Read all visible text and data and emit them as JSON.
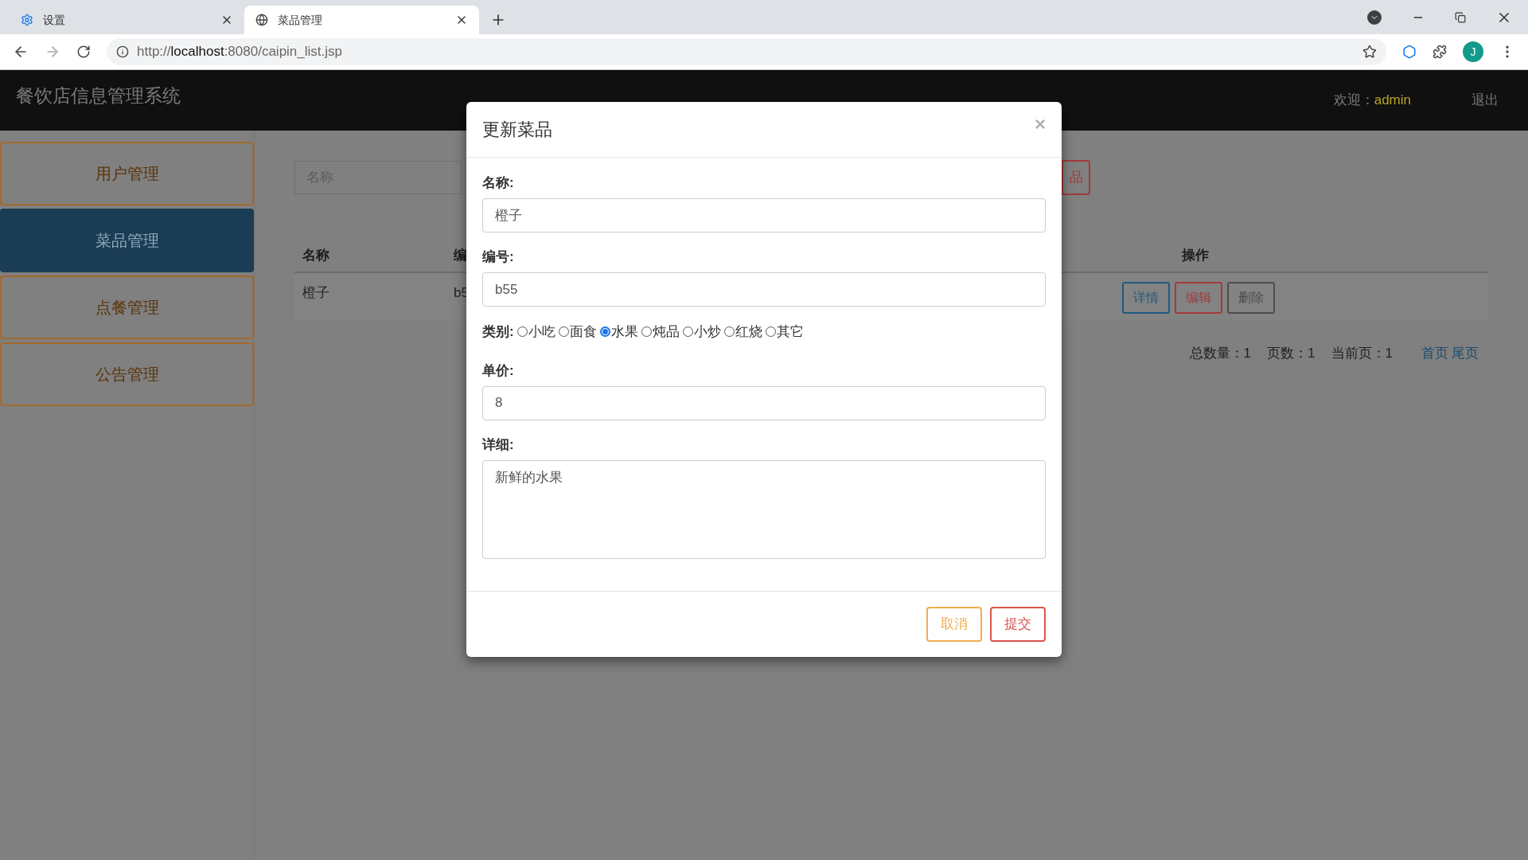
{
  "browser": {
    "tabs": [
      {
        "title": "设置",
        "kind": "settings",
        "selected": false
      },
      {
        "title": "菜品管理",
        "kind": "web",
        "selected": true
      }
    ],
    "url_scheme": "http://",
    "url_host": "localhost",
    "url_rest": ":8080/caipin_list.jsp",
    "profile_initial": "J"
  },
  "header": {
    "title": "餐饮店信息管理系统",
    "welcome_label": "欢迎：",
    "user": "admin",
    "logout": "退出"
  },
  "sidebar": {
    "items": [
      {
        "label": "用户管理",
        "selected": false
      },
      {
        "label": "菜品管理",
        "selected": true
      },
      {
        "label": "点餐管理",
        "selected": false
      },
      {
        "label": "公告管理",
        "selected": false
      }
    ]
  },
  "search": {
    "placeholder": "名称"
  },
  "add_button": "品",
  "table": {
    "columns": [
      "名称",
      "编",
      "操作"
    ],
    "rows": [
      {
        "cells": [
          "橙子",
          "b5"
        ],
        "actions": [
          {
            "label": "详情",
            "kind": "info"
          },
          {
            "label": "编辑",
            "kind": "edit"
          },
          {
            "label": "删除",
            "kind": "delete"
          }
        ]
      }
    ]
  },
  "pagination": {
    "stats": [
      "总数量：1",
      "页数：1",
      "当前页：1"
    ],
    "links": [
      "首页",
      "尾页"
    ]
  },
  "modal": {
    "title": "更新菜品",
    "close": "×",
    "fields": [
      {
        "kind": "text",
        "label": "名称:",
        "value": "橙子"
      },
      {
        "kind": "text",
        "label": "编号:",
        "value": "b55"
      },
      {
        "kind": "radio",
        "label": "类别:",
        "options": [
          {
            "label": "小吃",
            "selected": false
          },
          {
            "label": "面食",
            "selected": false
          },
          {
            "label": "水果",
            "selected": true
          },
          {
            "label": "炖品",
            "selected": false
          },
          {
            "label": "小炒",
            "selected": false
          },
          {
            "label": "红烧",
            "selected": false
          },
          {
            "label": "其它",
            "selected": false
          }
        ]
      },
      {
        "kind": "text",
        "label": "单价:",
        "value": "8"
      },
      {
        "kind": "textarea",
        "label": "详细:",
        "value": "新鲜的水果"
      }
    ],
    "buttons": [
      {
        "label": "取消",
        "kind": "cancel"
      },
      {
        "label": "提交",
        "kind": "submit"
      }
    ]
  }
}
